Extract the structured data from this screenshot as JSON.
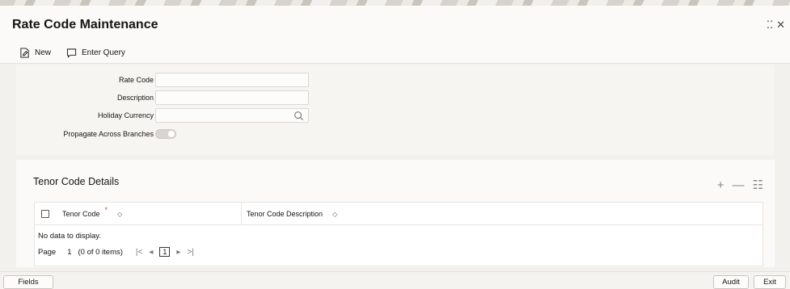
{
  "window": {
    "title": "Rate Code Maintenance",
    "controls": {
      "resize": "⁚⁚",
      "close": "✕"
    }
  },
  "toolbar": {
    "new_label": "New",
    "enter_query_label": "Enter Query"
  },
  "form": {
    "rate_code": {
      "label": "Rate Code",
      "value": "",
      "required": "*"
    },
    "description": {
      "label": "Description",
      "value": ""
    },
    "holiday_currency": {
      "label": "Holiday Currency",
      "value": ""
    },
    "propagate": {
      "label": "Propagate Across Branches",
      "checked": false
    }
  },
  "tenor_panel": {
    "title": "Tenor Code Details",
    "actions": {
      "add": "+",
      "remove": "—",
      "columns": "☷"
    },
    "columns": [
      {
        "label": "Tenor Code",
        "required": "*",
        "sort": "◇"
      },
      {
        "label": "Tenor Code Description",
        "sort": "◇"
      }
    ],
    "empty_text": "No data to display.",
    "pager": {
      "page_label": "Page",
      "page_value": "1",
      "info": "(0 of 0 items)",
      "first": "|<",
      "prev": "◂",
      "current": "1",
      "next": "▸",
      "last": ">|"
    }
  },
  "footer": {
    "fields_label": "Fields",
    "audit_label": "Audit",
    "exit_label": "Exit"
  }
}
